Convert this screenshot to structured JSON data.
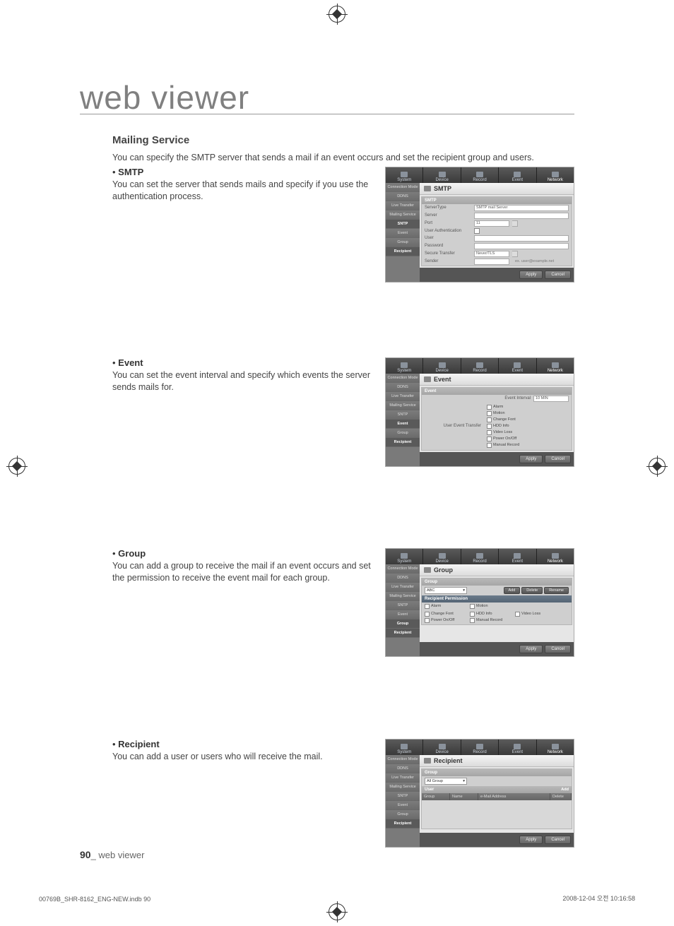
{
  "page_title": "web viewer",
  "section_heading": "Mailing Service",
  "section_intro": "You can specify the SMTP server that sends a mail if an event occurs and set the recipient group and users.",
  "smtp": {
    "heading": "SMTP",
    "body": "You can set the server that sends mails and specify if you use the authentication process.",
    "shot": {
      "tabs": [
        "System",
        "Device",
        "Record",
        "Event",
        "Network"
      ],
      "side": [
        "Connection Mode",
        "DDNS",
        "Live Transfer",
        "Mailing Service",
        "SNTP",
        "Event",
        "Group",
        "Recipient"
      ],
      "title": "SMTP",
      "panel_head": "SMTP",
      "rows": {
        "server_type_lbl": "ServerType",
        "server_type_val": "SMTP mail Server",
        "server_lbl": "Server",
        "port_lbl": "Port",
        "port_val": "11",
        "auth_lbl": "User Authentication",
        "user_lbl": "User",
        "pass_lbl": "Password",
        "secure_lbl": "Secure Transfer",
        "secure_val": "Never/TLS",
        "sender_lbl": "Sender",
        "sender_hint": "ex. user@example.net"
      },
      "apply": "Apply",
      "cancel": "Cancel"
    }
  },
  "event": {
    "heading": "Event",
    "body": "You can set the event interval and specify which events the server sends mails for.",
    "shot": {
      "title": "Event",
      "panel_head": "Event",
      "interval_lbl": "Event Interval",
      "interval_val": "10 MIN",
      "transfer_lbl": "User Event Transfer",
      "checks": [
        "Alarm",
        "Motion",
        "Change Font",
        "HDD Info",
        "Video Loss",
        "Power On/Off",
        "Manual Record"
      ]
    }
  },
  "group": {
    "heading": "Group",
    "body": "You can add a group to receive the mail if an event occurs and set the permission to receive the event mail for each group.",
    "shot": {
      "title": "Group",
      "panel_head": "Group",
      "select_val": "ABC",
      "btn_add": "Add",
      "btn_del": "Delete",
      "btn_ren": "Rename",
      "perm_head": "Recipient Permission",
      "checks": [
        "Alarm",
        "Motion",
        "Change Font",
        "HDD Info",
        "Video Loss",
        "Power On/Off",
        "Manual Record"
      ]
    }
  },
  "recipient": {
    "heading": "Recipient",
    "body": "You can add a user or users who will receive the mail.",
    "shot": {
      "title": "Recipient",
      "group_head": "Group",
      "group_val": "All Group",
      "user_head": "User",
      "btn_add": "Add",
      "cols": {
        "group": "Group",
        "name": "Name",
        "mail": "e-Mail Address",
        "del": "Delete"
      }
    }
  },
  "common_shot": {
    "apply": "Apply",
    "cancel": "Cancel"
  },
  "footer": {
    "page_num": "90",
    "page_label": "web viewer",
    "file": "00769B_SHR-8162_ENG-NEW.indb   90",
    "timestamp": "2008-12-04   오전 10:16:58"
  }
}
